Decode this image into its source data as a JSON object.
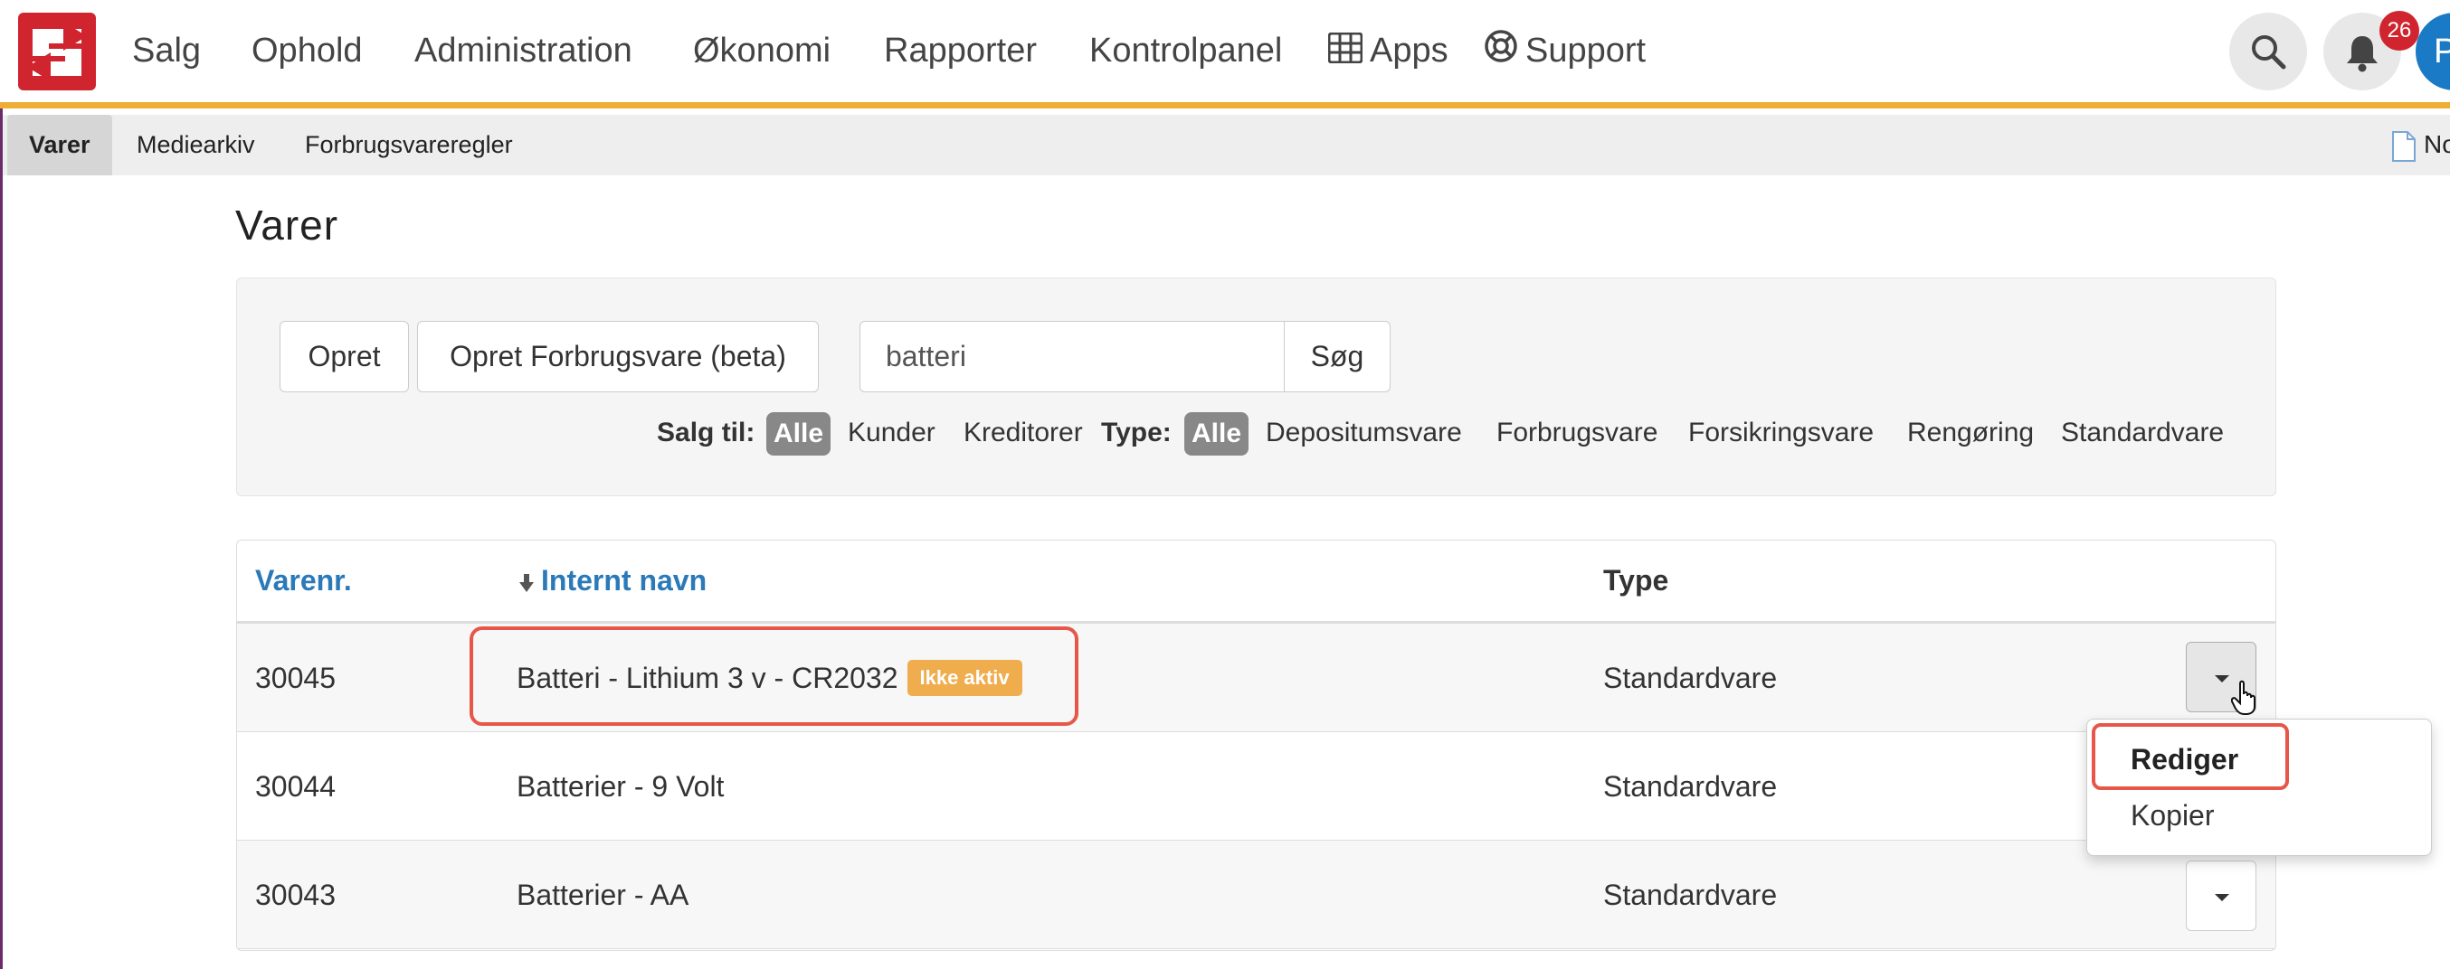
{
  "nav": {
    "items": [
      "Salg",
      "Ophold",
      "Administration",
      "Økonomi",
      "Rapporter",
      "Kontrolpanel",
      "Apps",
      "Support"
    ],
    "notification_count": "26",
    "avatar_initial": "P"
  },
  "subnav": {
    "items": [
      "Varer",
      "Mediearkiv",
      "Forbrugsvareregler"
    ],
    "active": "Varer",
    "doc_link": "No"
  },
  "page": {
    "title": "Varer"
  },
  "toolbar": {
    "create_label": "Opret",
    "create_consumable_label": "Opret Forbrugsvare (beta)",
    "search_value": "batteri",
    "search_button": "Søg"
  },
  "filters": {
    "sales_label": "Salg til:",
    "sales_options": [
      "Alle",
      "Kunder",
      "Kreditorer"
    ],
    "type_label": "Type:",
    "type_options": [
      "Alle",
      "Depositumsvare",
      "Forbrugsvare",
      "Forsikringsvare",
      "Rengøring",
      "Standardvare"
    ]
  },
  "table": {
    "columns": [
      "Varenr.",
      "Internt navn",
      "Type"
    ],
    "rows": [
      {
        "number": "30045",
        "name": "Batteri - Lithium 3 v - CR2032",
        "badge": "Ikke aktiv",
        "type": "Standardvare"
      },
      {
        "number": "30044",
        "name": "Batterier - 9 Volt",
        "type": "Standardvare"
      },
      {
        "number": "30043",
        "name": "Batterier - AA",
        "type": "Standardvare"
      }
    ]
  },
  "dropdown": {
    "items": [
      "Rediger",
      "Kopier"
    ]
  },
  "colors": {
    "brand_red": "#d0242f",
    "accent_orange": "#f0ad33",
    "link_blue": "#2a7ab9",
    "highlight_red": "#e6574a",
    "badge_orange": "#f0ad4e"
  }
}
